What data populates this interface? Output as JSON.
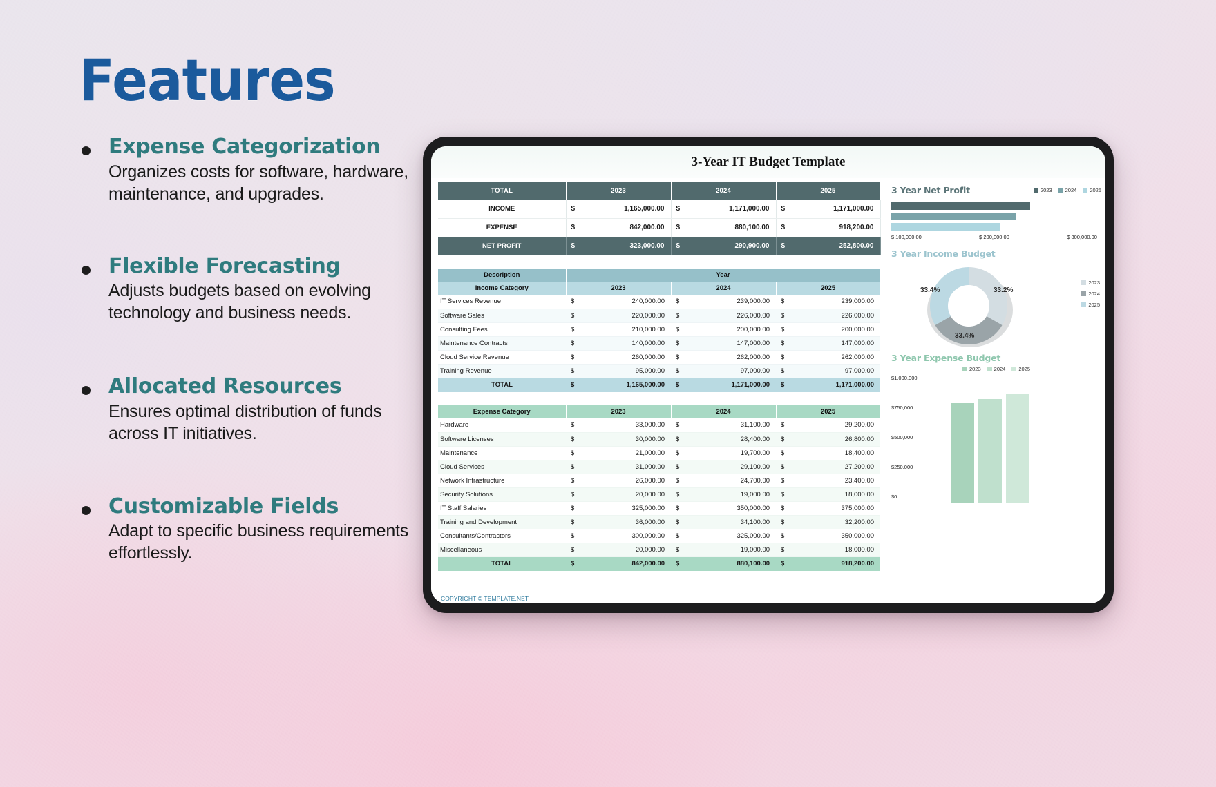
{
  "slide": {
    "title": "Features",
    "features": [
      {
        "title": "Expense Categorization",
        "desc": "Organizes costs for software, hardware, maintenance, and upgrades."
      },
      {
        "title": "Flexible Forecasting",
        "desc": "Adjusts budgets based on evolving technology and business needs."
      },
      {
        "title": "Allocated Resources",
        "desc": "Ensures optimal distribution of funds across IT initiatives."
      },
      {
        "title": "Customizable Fields",
        "desc": "Adapt to specific business requirements effortlessly."
      }
    ],
    "colors": {
      "title_blue": "#1b5a9c",
      "feature_teal": "#2f7b7e",
      "body_text": "#1a1a1a"
    }
  },
  "spreadsheet": {
    "title": "3-Year IT Budget Template",
    "footer": "COPYRIGHT © TEMPLATE.NET",
    "currency_symbol": "$",
    "summary": {
      "header": [
        "TOTAL",
        "2023",
        "2024",
        "2025"
      ],
      "rows": [
        {
          "label": "INCOME",
          "values": [
            "1,165,000.00",
            "1,171,000.00",
            "1,171,000.00"
          ]
        },
        {
          "label": "EXPENSE",
          "values": [
            "842,000.00",
            "880,100.00",
            "918,200.00"
          ]
        },
        {
          "label": "NET PROFIT",
          "values": [
            "323,000.00",
            "290,900.00",
            "252,800.00"
          ]
        }
      ]
    },
    "income": {
      "desc_header": "Description",
      "year_header": "Year",
      "category_header": "Income Category",
      "years": [
        "2023",
        "2024",
        "2025"
      ],
      "rows": [
        {
          "name": "IT Services Revenue",
          "values": [
            "240,000.00",
            "239,000.00",
            "239,000.00"
          ]
        },
        {
          "name": "Software Sales",
          "values": [
            "220,000.00",
            "226,000.00",
            "226,000.00"
          ]
        },
        {
          "name": "Consulting Fees",
          "values": [
            "210,000.00",
            "200,000.00",
            "200,000.00"
          ]
        },
        {
          "name": "Maintenance Contracts",
          "values": [
            "140,000.00",
            "147,000.00",
            "147,000.00"
          ]
        },
        {
          "name": "Cloud Service Revenue",
          "values": [
            "260,000.00",
            "262,000.00",
            "262,000.00"
          ]
        },
        {
          "name": "Training Revenue",
          "values": [
            "95,000.00",
            "97,000.00",
            "97,000.00"
          ]
        }
      ],
      "total_label": "TOTAL",
      "total_values": [
        "1,165,000.00",
        "1,171,000.00",
        "1,171,000.00"
      ]
    },
    "expense": {
      "category_header": "Expense Category",
      "years": [
        "2023",
        "2024",
        "2025"
      ],
      "rows": [
        {
          "name": "Hardware",
          "values": [
            "33,000.00",
            "31,100.00",
            "29,200.00"
          ]
        },
        {
          "name": "Software Licenses",
          "values": [
            "30,000.00",
            "28,400.00",
            "26,800.00"
          ]
        },
        {
          "name": "Maintenance",
          "values": [
            "21,000.00",
            "19,700.00",
            "18,400.00"
          ]
        },
        {
          "name": "Cloud Services",
          "values": [
            "31,000.00",
            "29,100.00",
            "27,200.00"
          ]
        },
        {
          "name": "Network Infrastructure",
          "values": [
            "26,000.00",
            "24,700.00",
            "23,400.00"
          ]
        },
        {
          "name": "Security Solutions",
          "values": [
            "20,000.00",
            "19,000.00",
            "18,000.00"
          ]
        },
        {
          "name": "IT Staff Salaries",
          "values": [
            "325,000.00",
            "350,000.00",
            "375,000.00"
          ]
        },
        {
          "name": "Training and Development",
          "values": [
            "36,000.00",
            "34,100.00",
            "32,200.00"
          ]
        },
        {
          "name": "Consultants/Contractors",
          "values": [
            "300,000.00",
            "325,000.00",
            "350,000.00"
          ]
        },
        {
          "name": "Miscellaneous",
          "values": [
            "20,000.00",
            "19,000.00",
            "18,000.00"
          ]
        }
      ],
      "total_label": "TOTAL",
      "total_values": [
        "842,000.00",
        "880,100.00",
        "918,200.00"
      ]
    }
  },
  "chart_data": [
    {
      "type": "bar",
      "orientation": "horizontal",
      "title": "3 Year Net Profit",
      "categories": [
        "2023",
        "2024",
        "2025"
      ],
      "series": [
        {
          "name": "Net Profit",
          "values": [
            323000,
            290900,
            252800
          ]
        }
      ],
      "legend": [
        "2023",
        "2024",
        "2025"
      ],
      "legend_position": "top-right",
      "xticks": [
        "$ 100,000.00",
        "$ 200,000.00",
        "$ 300,000.00"
      ],
      "xlim": [
        0,
        350000
      ],
      "colors": [
        "#516a6d",
        "#7aa3a9",
        "#aed6e0"
      ],
      "grid": false
    },
    {
      "type": "pie",
      "variant": "donut",
      "title": "3 Year Income Budget",
      "labels": [
        "2023",
        "2024",
        "2025"
      ],
      "values": [
        33.4,
        33.2,
        33.4
      ],
      "data_labels": [
        "33.4%",
        "33.2%",
        "33.4%"
      ],
      "legend": [
        "2023",
        "2024",
        "2025"
      ],
      "legend_position": "right",
      "colors": [
        "#d3dde2",
        "#9aa4a8",
        "#bcd9e3"
      ]
    },
    {
      "type": "bar",
      "orientation": "vertical",
      "title": "3 Year Expense Budget",
      "categories": [
        "2023",
        "2024",
        "2025"
      ],
      "series": [
        {
          "name": "Expense",
          "values": [
            842000,
            880100,
            918200
          ]
        }
      ],
      "legend": [
        "2023",
        "2024",
        "2025"
      ],
      "legend_position": "top-right",
      "yticks": [
        "$1,000,000",
        "$750,000",
        "$500,000",
        "$250,000",
        "$0"
      ],
      "ylim": [
        0,
        1000000
      ],
      "colors": [
        "#a8d3bb",
        "#bfe0cd",
        "#cfe8d9"
      ],
      "grid": false
    }
  ]
}
